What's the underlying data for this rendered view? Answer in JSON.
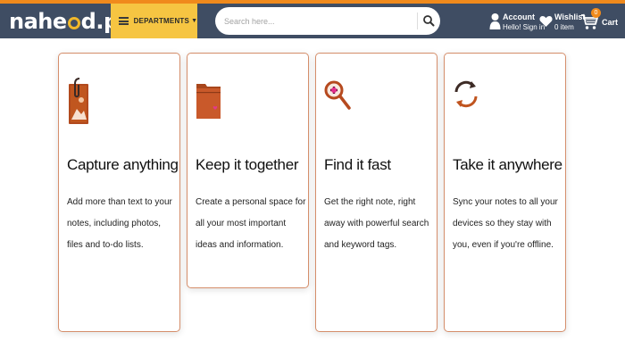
{
  "header": {
    "logo": "nahead.pk",
    "logo_left": "nahe",
    "logo_right": "d.pk",
    "departments_label": "DEPARTMENTS",
    "search_placeholder": "Search here...",
    "account": {
      "title": "Account",
      "subtitle": "Hello! Sign in"
    },
    "wishlist": {
      "title": "Wishlist",
      "subtitle": "0 item"
    },
    "cart": {
      "label": "Cart",
      "count": "0"
    },
    "colors": {
      "navbar": "#3f4d63",
      "departments": "#f6c542",
      "accent": "#f08a1c"
    }
  },
  "features": [
    {
      "icon": "photo-attachment-icon",
      "title": "Capture anything",
      "body": "Add more than text to your notes, including photos, files and to-do lists."
    },
    {
      "icon": "folder-icon",
      "title": "Keep it together",
      "body": "Create a personal space for all your most important ideas and information."
    },
    {
      "icon": "magnifier-icon",
      "title": "Find it fast",
      "body": "Get the right note, right away with powerful search and keyword tags."
    },
    {
      "icon": "sync-icon",
      "title": "Take it anywhere",
      "body": "Sync your notes to all your devices so they stay with you, even if you're offline."
    }
  ]
}
